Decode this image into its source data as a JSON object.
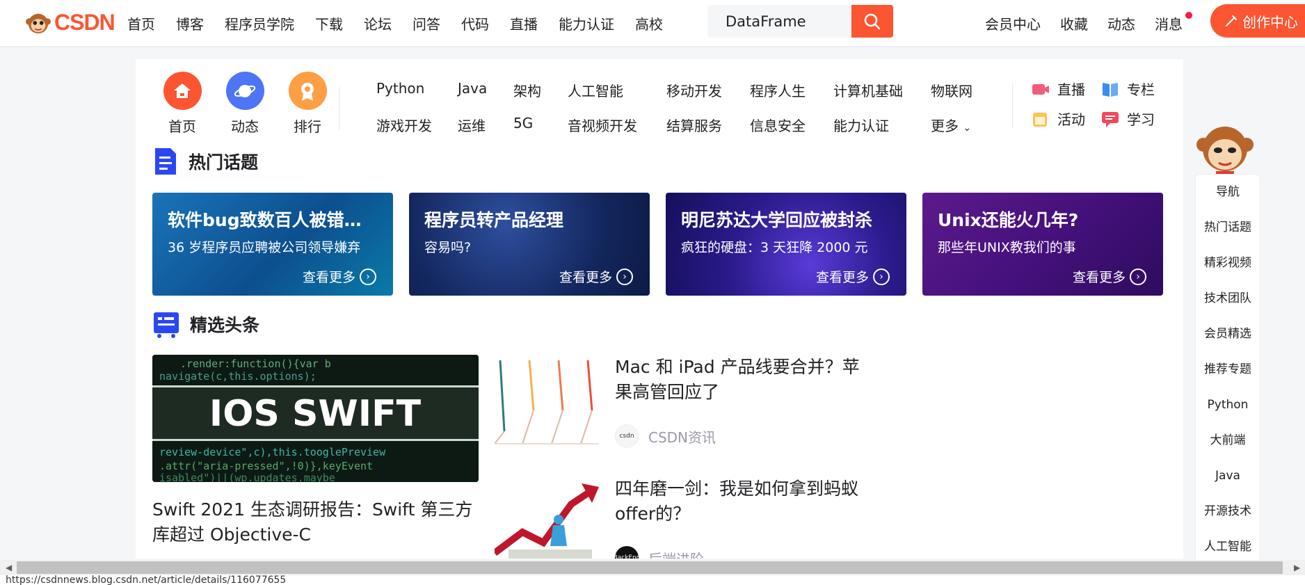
{
  "header": {
    "logo_text": "CSDN",
    "nav": [
      "首页",
      "博客",
      "程序员学院",
      "下载",
      "论坛",
      "问答",
      "代码",
      "直播",
      "能力认证",
      "高校"
    ],
    "search_value": "DataFrame",
    "right_nav": [
      "会员中心",
      "收藏",
      "动态",
      "消息"
    ],
    "create_label": "创作中心"
  },
  "quick_icons": [
    {
      "label": "首页",
      "color": "#fc5531"
    },
    {
      "label": "动态",
      "color": "#4e75f5"
    },
    {
      "label": "排行",
      "color": "#ff9f45"
    }
  ],
  "categories": {
    "row1": [
      "Python",
      "Java",
      "架构",
      "人工智能",
      "移动开发",
      "程序人生",
      "计算机基础",
      "物联网"
    ],
    "row2": [
      "游戏开发",
      "运维",
      "5G",
      "音视频开发",
      "结算服务",
      "信息安全",
      "能力认证",
      "更多"
    ]
  },
  "side_links": [
    "直播",
    "专栏",
    "活动",
    "学习"
  ],
  "hot_topics": {
    "title": "热门话题",
    "cards": [
      {
        "title": "软件bug致数百人被错误定罪",
        "sub": "36 岁程序员应聘被公司领导嫌弃",
        "more": "查看更多"
      },
      {
        "title": "程序员转产品经理",
        "sub": "容易吗?",
        "more": "查看更多"
      },
      {
        "title": "明尼苏达大学回应被封杀",
        "sub": "疯狂的硬盘：3 天狂降 2000 元",
        "more": "查看更多"
      },
      {
        "title": "Unix还能火几年?",
        "sub": "那些年UNIX教我们的事",
        "more": "查看更多"
      }
    ]
  },
  "headlines": {
    "title": "精选头条",
    "main": {
      "image_text": "IOS SWIFT",
      "title": "Swift 2021 生态调研报告：Swift 第三方库超过 Objective-C"
    },
    "items": [
      {
        "title": "Mac 和 iPad 产品线要合并？苹果高管回应了",
        "author": "CSDN资讯",
        "avatar": "csdn"
      },
      {
        "title": "四年磨一剑：我是如何拿到蚂蚁offer的？",
        "author": "后端进阶",
        "avatar": "BackEnd"
      }
    ]
  },
  "float_nav": [
    "导航",
    "热门话题",
    "精彩视频",
    "技术团队",
    "会员精选",
    "推荐专题",
    "Python",
    "大前端",
    "Java",
    "开源技术",
    "人工智能"
  ],
  "status_url": "https://csdnnews.blog.csdn.net/article/details/116077655"
}
